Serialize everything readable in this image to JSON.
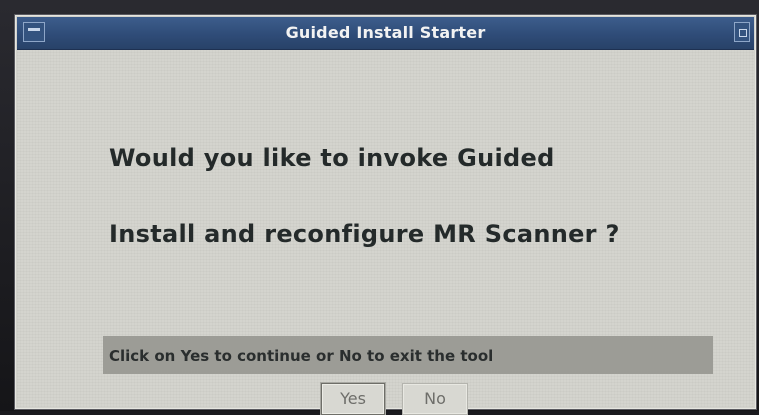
{
  "window": {
    "title": "Guided Install Starter"
  },
  "dialog": {
    "question_line1": "Would you like to invoke Guided",
    "question_line2": "Install and reconfigure MR Scanner ?",
    "status_text": "Click on Yes to continue or No to exit the tool"
  },
  "buttons": {
    "yes_label": "Yes",
    "no_label": "No"
  },
  "icons": {
    "window_menu": "window-menu-icon",
    "maximize": "maximize-icon"
  },
  "colors": {
    "titlebar": "#2f4c78",
    "window_background": "#d2d2cc",
    "status_bar": "#9c9c96",
    "text": "#242a2a"
  }
}
